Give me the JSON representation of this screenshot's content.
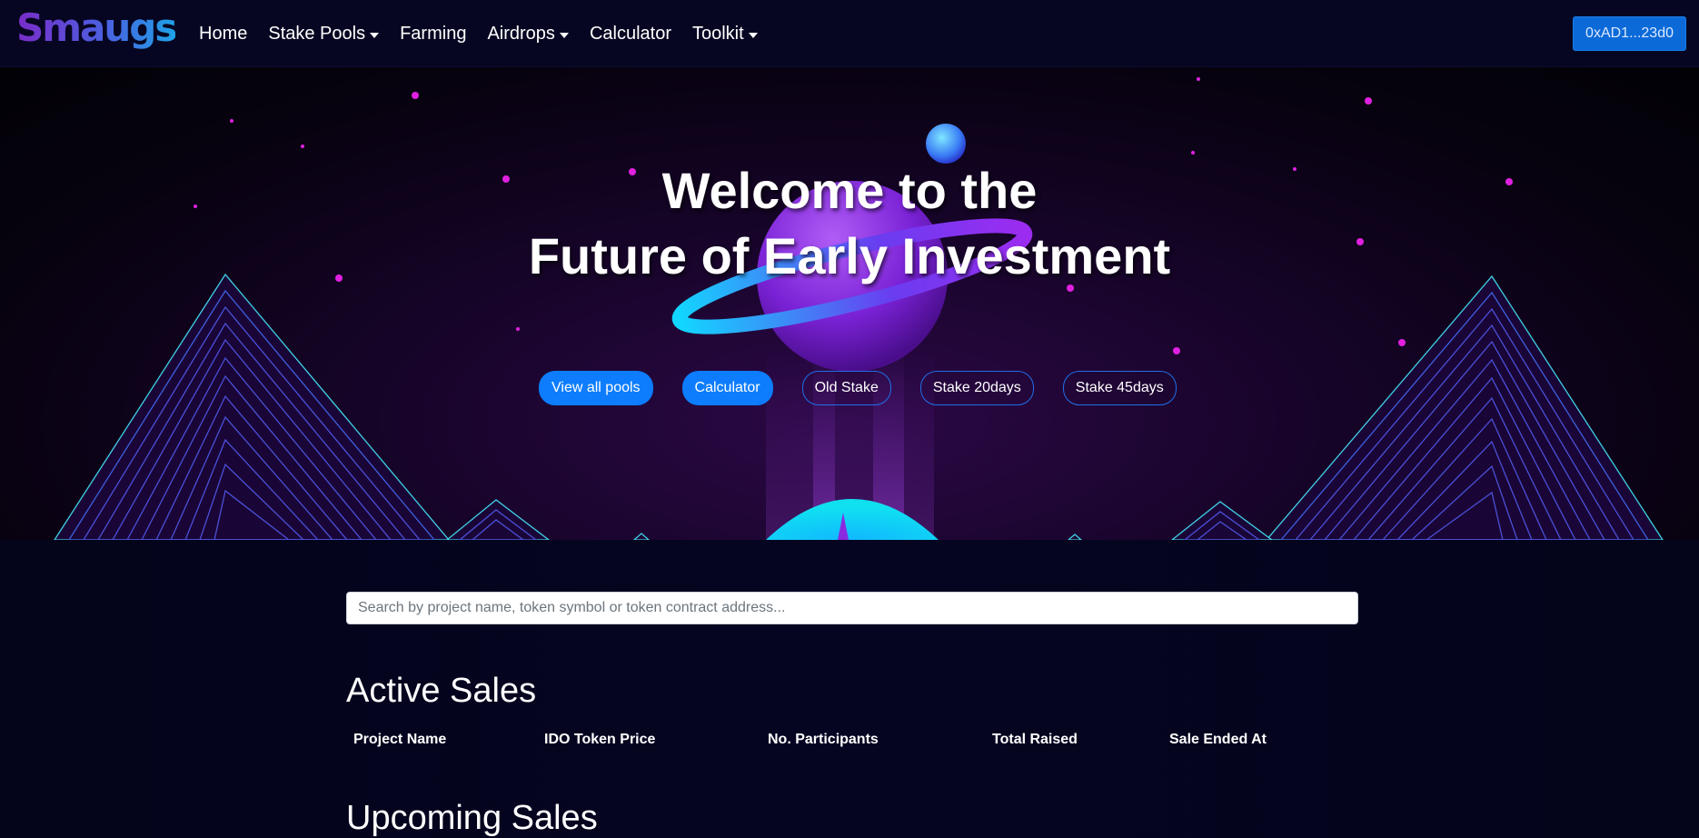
{
  "navbar": {
    "brand": "Smaugs",
    "items": [
      {
        "label": "Home",
        "dropdown": false
      },
      {
        "label": "Stake Pools",
        "dropdown": true
      },
      {
        "label": "Farming",
        "dropdown": false
      },
      {
        "label": "Airdrops",
        "dropdown": true
      },
      {
        "label": "Calculator",
        "dropdown": false
      },
      {
        "label": "Toolkit",
        "dropdown": true
      }
    ],
    "wallet": "0xAD1...23d0"
  },
  "hero": {
    "title_line1": "Welcome to the",
    "title_line2": "Future of Early Investment",
    "buttons": [
      {
        "label": "View all pools",
        "style": "filled"
      },
      {
        "label": "Calculator",
        "style": "filled"
      },
      {
        "label": "Old Stake",
        "style": "outline"
      },
      {
        "label": "Stake 20days",
        "style": "outline"
      },
      {
        "label": "Stake 45days",
        "style": "outline"
      }
    ]
  },
  "search": {
    "placeholder": "Search by project name, token symbol or token contract address...",
    "value": ""
  },
  "active_sales": {
    "title": "Active Sales",
    "columns": [
      "Project Name",
      "IDO Token Price",
      "No. Participants",
      "Total Raised",
      "Sale Ended At"
    ]
  },
  "upcoming_sales": {
    "title": "Upcoming Sales"
  },
  "colors": {
    "primary_button": "#0d7dfd",
    "wallet_button": "#0b6ad8",
    "background": "#050520",
    "star": "#e020e0"
  }
}
